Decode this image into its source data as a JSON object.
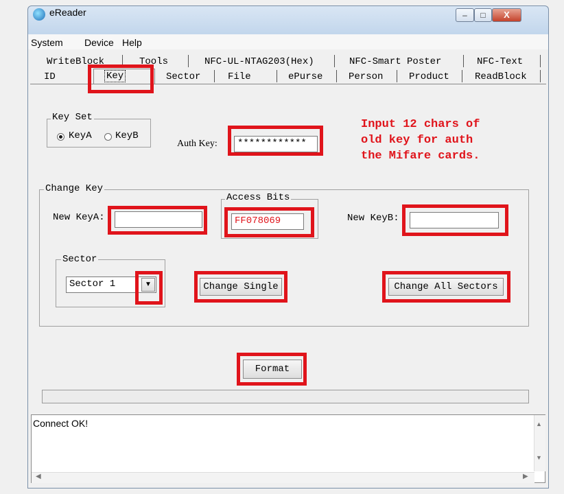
{
  "window": {
    "title": "eReader",
    "buttons": {
      "minimize": "–",
      "maximize": "□",
      "close": "X"
    }
  },
  "menu": [
    "System",
    "Device",
    "Help"
  ],
  "tabs": {
    "row1": [
      "WriteBlock",
      "Tools",
      "NFC-UL-NTAG203(Hex)",
      "NFC-Smart Poster",
      "NFC-Text"
    ],
    "row2": [
      "ID",
      "Key",
      "Sector",
      "File",
      "ePurse",
      "Person",
      "Product",
      "ReadBlock"
    ],
    "selected": "Key"
  },
  "key_set": {
    "label": "Key Set",
    "options": [
      "KeyA",
      "KeyB"
    ],
    "selected": "KeyA"
  },
  "auth_key": {
    "label": "Auth Key:",
    "value": "************"
  },
  "hint": {
    "lines": [
      "Input 12 chars of",
      "old key for auth",
      "the Mifare cards."
    ]
  },
  "change_key": {
    "label": "Change Key",
    "new_key_a_label": "New KeyA:",
    "new_key_a_value": "",
    "access_bits_label": "Access Bits",
    "access_bits_value": "FF078069",
    "new_key_b_label": "New KeyB:",
    "new_key_b_value": "",
    "sector_label": "Sector",
    "sector_value": "Sector 1",
    "change_single": "Change Single",
    "change_all": "Change All Sectors"
  },
  "format_button": "Format",
  "log": {
    "text": "Connect OK!"
  },
  "colors": {
    "highlight": "#e0141b",
    "access_bits_text": "#e0141b"
  }
}
